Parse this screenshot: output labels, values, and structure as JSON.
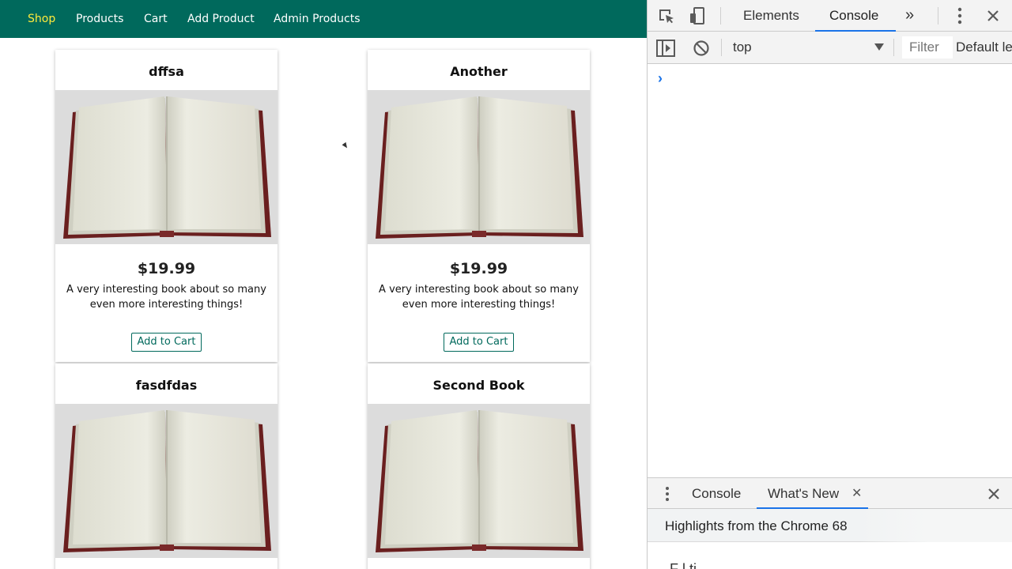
{
  "nav": {
    "items": [
      {
        "label": "Shop",
        "active": true
      },
      {
        "label": "Products",
        "active": false
      },
      {
        "label": "Cart",
        "active": false
      },
      {
        "label": "Add Product",
        "active": false
      },
      {
        "label": "Admin Products",
        "active": false
      }
    ],
    "background_color": "#00695c",
    "active_color": "#ffeb3b"
  },
  "products": [
    {
      "title": "dffsa",
      "price": "$19.99",
      "description": "A very interesting book about so many even more interesting things!",
      "button": "Add to Cart",
      "image": "open-book-image"
    },
    {
      "title": "Another",
      "price": "$19.99",
      "description": "A very interesting book about so many even more interesting things!",
      "button": "Add to Cart",
      "image": "open-book-image"
    },
    {
      "title": "fasdfdas",
      "image": "open-book-image"
    },
    {
      "title": "Second Book",
      "image": "open-book-image"
    }
  ],
  "devtools": {
    "tabs": [
      "Elements",
      "Console"
    ],
    "active_tab": "Console",
    "more_tabs_label": "»",
    "context": "top",
    "filter_placeholder": "Filter",
    "levels_label": "Default le",
    "console_prompt": "›",
    "drawer": {
      "tabs": [
        "Console",
        "What's New"
      ],
      "active_tab": "What's New",
      "close_label": "✕"
    },
    "whats_new": {
      "title": "Highlights from the Chrome 68",
      "subtitle": "F          l   ti"
    },
    "accent_color": "#1a73e8"
  }
}
